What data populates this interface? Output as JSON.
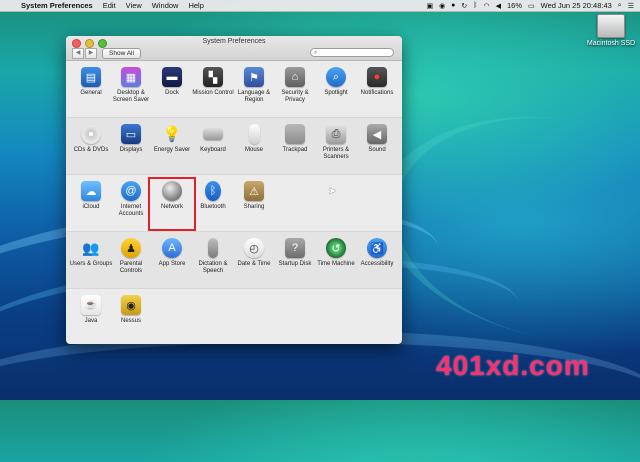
{
  "menubar": {
    "app": "System Preferences",
    "items": [
      "Edit",
      "View",
      "Window",
      "Help"
    ],
    "battery": "16%",
    "clock": "Wed Jun 25  20:48:43"
  },
  "desktop": {
    "disk_label": "Macintosh SSD"
  },
  "window": {
    "title": "System Preferences",
    "show_all": "Show All",
    "search_placeholder": ""
  },
  "rows": [
    [
      "General",
      "Desktop & Screen Saver",
      "Dock",
      "Mission Control",
      "Language & Region",
      "Security & Privacy",
      "Spotlight",
      "Notifications"
    ],
    [
      "CDs & DVDs",
      "Displays",
      "Energy Saver",
      "Keyboard",
      "Mouse",
      "Trackpad",
      "Printers & Scanners",
      "Sound"
    ],
    [
      "iCloud",
      "Internet Accounts",
      "Network",
      "Bluetooth",
      "Sharing"
    ],
    [
      "Users & Groups",
      "Parental Controls",
      "App Store",
      "Dictation & Speech",
      "Date & Time",
      "Startup Disk",
      "Time Machine",
      "Accessibility"
    ],
    [
      "Java",
      "Nessus"
    ]
  ],
  "selected": "Network",
  "watermark": "401xd.com",
  "colors": {
    "selection": "#e0212a",
    "watermark": "#ff2f6e"
  }
}
